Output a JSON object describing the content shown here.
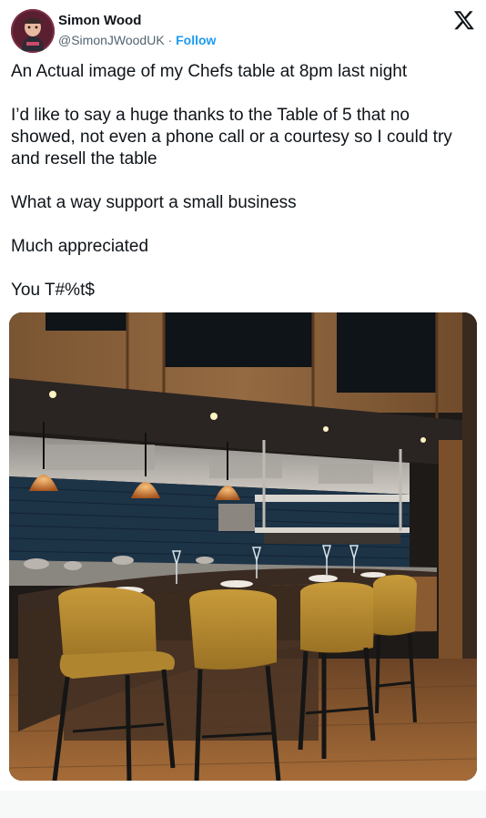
{
  "author": {
    "name": "Simon Wood",
    "handle": "@SimonJWoodUK",
    "separator": "·",
    "follow_label": "Follow",
    "avatar_icon": "avatar-icon"
  },
  "platform_icon": "x-logo-icon",
  "tweet": {
    "paragraphs": [
      "An Actual image of my Chefs table at 8pm last night",
      "I’d like to say a huge thanks to the Table of 5 that no showed, not even a phone call or a courtesy so I could try and resell the table",
      "What a way support a small business",
      "Much appreciated",
      "You T#%t$"
    ]
  },
  "colors": {
    "text": "#0f1419",
    "secondary": "#536471",
    "accent": "#1d9bf0"
  }
}
